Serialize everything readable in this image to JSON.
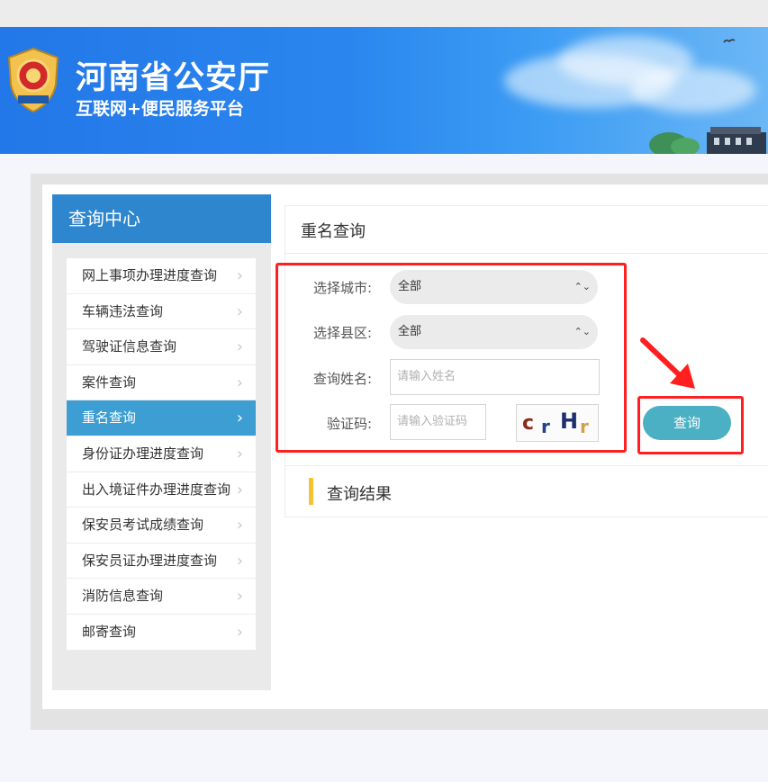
{
  "header": {
    "title": "河南省公安厅",
    "subtitle": "互联网+便民服务平台"
  },
  "sidebar": {
    "title": "查询中心",
    "items": [
      {
        "label": "网上事项办理进度查询"
      },
      {
        "label": "车辆违法查询"
      },
      {
        "label": "驾驶证信息查询"
      },
      {
        "label": "案件查询"
      },
      {
        "label": "重名查询",
        "active": true
      },
      {
        "label": "身份证办理进度查询"
      },
      {
        "label": "出入境证件办理进度查询"
      },
      {
        "label": "保安员考试成绩查询"
      },
      {
        "label": "保安员证办理进度查询"
      },
      {
        "label": "消防信息查询"
      },
      {
        "label": "邮寄查询"
      }
    ]
  },
  "main": {
    "title": "重名查询",
    "form": {
      "city_label": "选择城市:",
      "city_value": "全部",
      "county_label": "选择县区:",
      "county_value": "全部",
      "name_label": "查询姓名:",
      "name_placeholder": "请输入姓名",
      "code_label": "验证码:",
      "code_placeholder": "请输入验证码",
      "captcha_chars": [
        "c",
        "r",
        "H",
        "r"
      ]
    },
    "query_button": "查询",
    "result_title": "查询结果"
  },
  "colors": {
    "accent": "#2e86cf",
    "active_menu": "#3d9ed3",
    "button": "#4bb0c4",
    "highlight_red": "#ff1f1f",
    "result_bar": "#f5c233"
  }
}
